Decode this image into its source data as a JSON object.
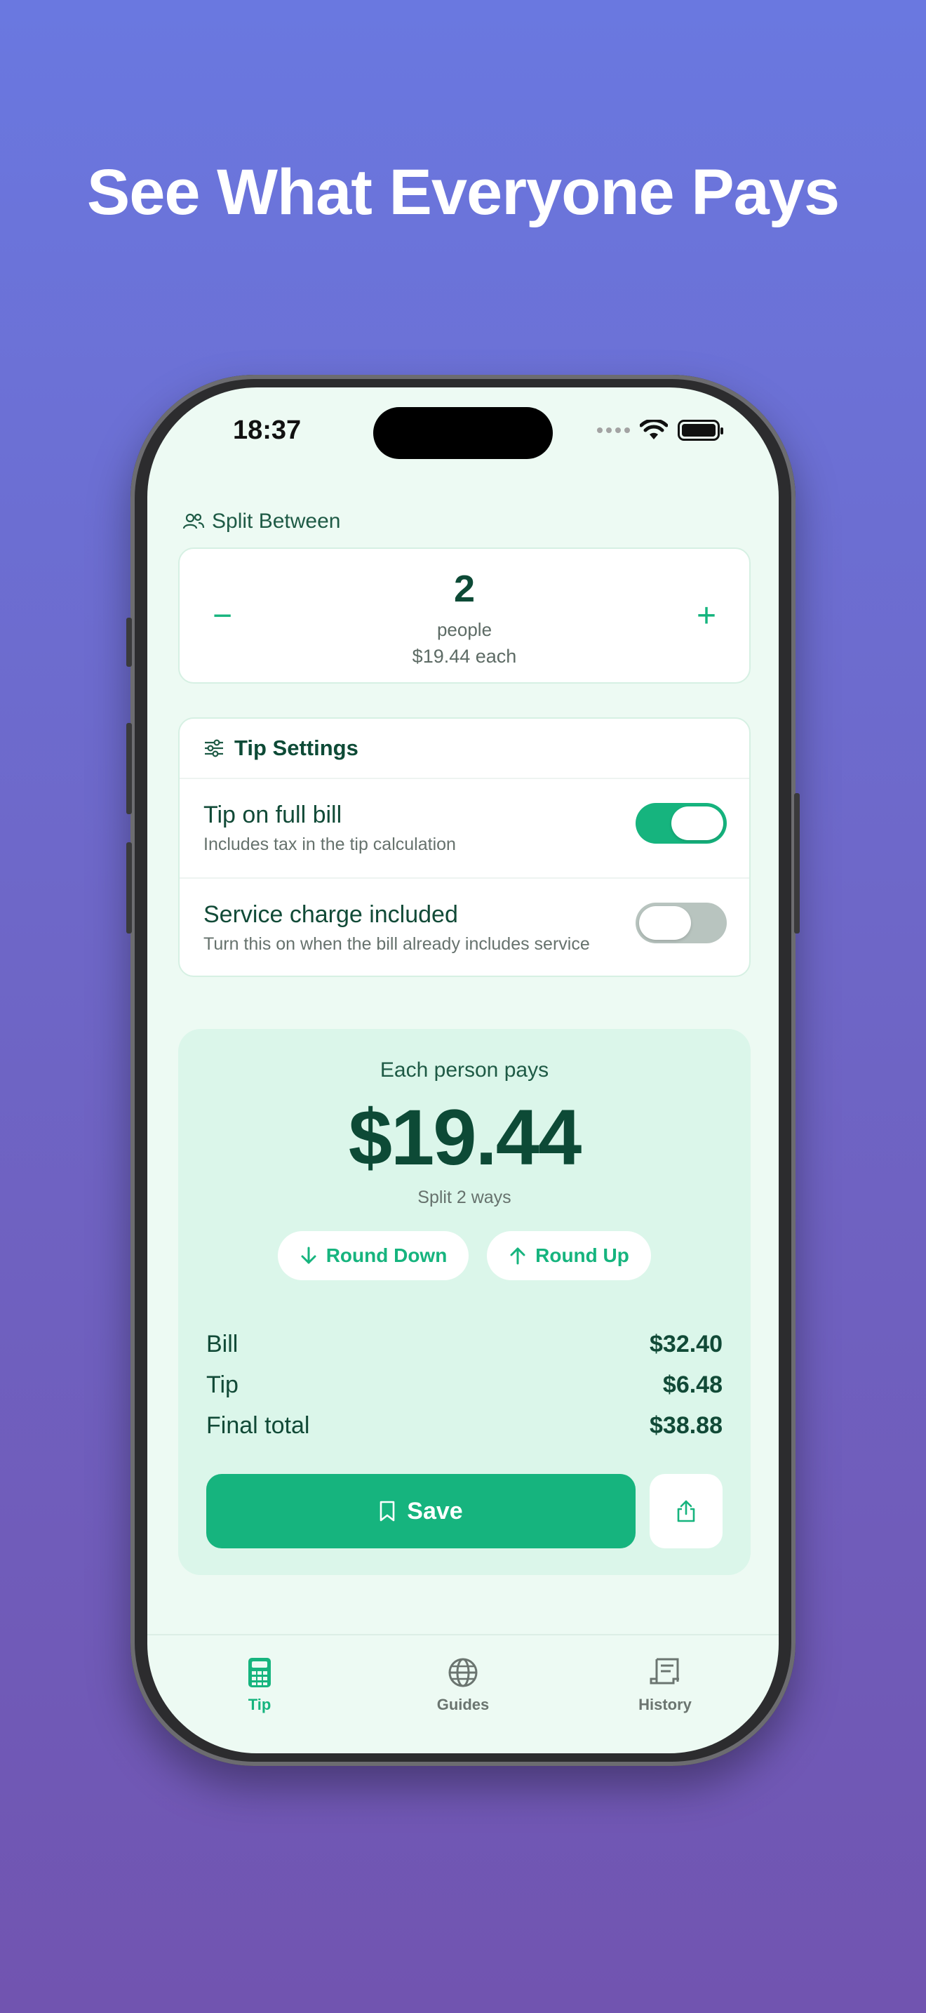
{
  "headline": "See What Everyone Pays",
  "status": {
    "time": "18:37"
  },
  "split": {
    "section_label": "Split Between",
    "minus": "−",
    "plus": "+",
    "count": "2",
    "unit": "people",
    "each": "$19.44 each"
  },
  "tip_settings": {
    "title": "Tip Settings",
    "rows": [
      {
        "title": "Tip on full bill",
        "subtitle": "Includes tax in the tip calculation",
        "on": true
      },
      {
        "title": "Service charge included",
        "subtitle": "Turn this on when the bill already includes service",
        "on": false
      }
    ]
  },
  "result": {
    "label": "Each person pays",
    "amount": "$19.44",
    "split_text": "Split 2 ways",
    "round_down": "Round Down",
    "round_up": "Round Up",
    "summary": [
      {
        "label": "Bill",
        "value": "$32.40"
      },
      {
        "label": "Tip",
        "value": "$6.48"
      },
      {
        "label": "Final total",
        "value": "$38.88"
      }
    ],
    "save": "Save"
  },
  "tabs": [
    {
      "label": "Tip",
      "icon": "calculator-icon",
      "active": true
    },
    {
      "label": "Guides",
      "icon": "globe-icon",
      "active": false
    },
    {
      "label": "History",
      "icon": "receipt-icon",
      "active": false
    }
  ],
  "colors": {
    "accent": "#16b47e",
    "dark_green": "#0d4a36",
    "screen_bg": "#edfaf3",
    "result_bg": "#dbf6ea"
  }
}
